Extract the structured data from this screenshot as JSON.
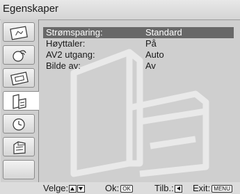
{
  "menu": {
    "title": "Egenskaper"
  },
  "tabs": [
    {
      "icon": "picture-icon"
    },
    {
      "icon": "sound-icon"
    },
    {
      "icon": "screen-adjust-icon"
    },
    {
      "icon": "features-icon",
      "active": true
    },
    {
      "icon": "timer-icon"
    },
    {
      "icon": "setup-icon"
    },
    {
      "icon": "empty-tab"
    }
  ],
  "settings": [
    {
      "label": "Strømsparing:",
      "value": "Standard",
      "selected": true
    },
    {
      "label": "Høyttaler:",
      "value": "På"
    },
    {
      "label": "AV2 utgang:",
      "value": "Auto"
    },
    {
      "label": "Bilde av:",
      "value": "Av"
    }
  ],
  "help": {
    "select_label": "Velge:",
    "ok_label": "Ok:",
    "ok_key": "OK",
    "back_label": "Tilb.:",
    "exit_label": "Exit:",
    "exit_key": "MENU"
  },
  "colors": {
    "selected_row": "#686868",
    "background": "#cfcfcf"
  }
}
